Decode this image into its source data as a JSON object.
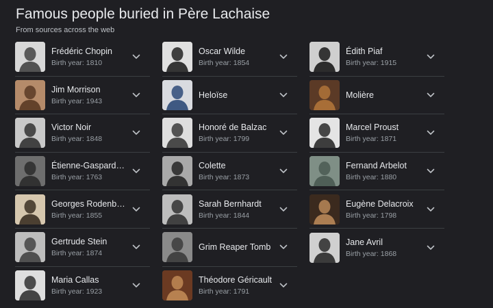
{
  "header": {
    "title": "Famous people buried in Père Lachaise",
    "subtitle": "From sources across the web"
  },
  "birth_prefix": "Birth year: ",
  "people": [
    {
      "name": "Frédéric Chopin",
      "birth": "1810",
      "thumb_bg": "#d8d8d8",
      "thumb_fg": "#444444"
    },
    {
      "name": "Oscar Wilde",
      "birth": "1854",
      "thumb_bg": "#e0e0e0",
      "thumb_fg": "#222222"
    },
    {
      "name": "Édith Piaf",
      "birth": "1915",
      "thumb_bg": "#cfcfcf",
      "thumb_fg": "#1a1a1a"
    },
    {
      "name": "Jim Morrison",
      "birth": "1943",
      "thumb_bg": "#b58b6a",
      "thumb_fg": "#5a3a24"
    },
    {
      "name": "Heloïse",
      "birth": "",
      "thumb_bg": "#d9dbe0",
      "thumb_fg": "#2e4a78"
    },
    {
      "name": "Molière",
      "birth": "",
      "thumb_bg": "#5b3a26",
      "thumb_fg": "#b0743a"
    },
    {
      "name": "Victor Noir",
      "birth": "1848",
      "thumb_bg": "#c9c9c9",
      "thumb_fg": "#333333"
    },
    {
      "name": "Honoré de Balzac",
      "birth": "1799",
      "thumb_bg": "#dedede",
      "thumb_fg": "#3a3a3a"
    },
    {
      "name": "Marcel Proust",
      "birth": "1871",
      "thumb_bg": "#e4e4e4",
      "thumb_fg": "#2a2a2a"
    },
    {
      "name": "Étienne-Gaspard R...",
      "birth": "1763",
      "thumb_bg": "#6e6e6e",
      "thumb_fg": "#2b2b2b"
    },
    {
      "name": "Colette",
      "birth": "1873",
      "thumb_bg": "#a9a9a9",
      "thumb_fg": "#262626"
    },
    {
      "name": "Fernand Arbelot",
      "birth": "1880",
      "thumb_bg": "#7f8f86",
      "thumb_fg": "#4a5a52"
    },
    {
      "name": "Georges Rodenbach",
      "birth": "1855",
      "thumb_bg": "#d6c7ae",
      "thumb_fg": "#3c3023"
    },
    {
      "name": "Sarah Bernhardt",
      "birth": "1844",
      "thumb_bg": "#bdbdbd",
      "thumb_fg": "#333333"
    },
    {
      "name": "Eugène Delacroix",
      "birth": "1798",
      "thumb_bg": "#3b2a1e",
      "thumb_fg": "#b98758"
    },
    {
      "name": "Gertrude Stein",
      "birth": "1874",
      "thumb_bg": "#bdbdbd",
      "thumb_fg": "#444444"
    },
    {
      "name": "Grim Reaper Tomb",
      "birth": "",
      "thumb_bg": "#8a8a8a",
      "thumb_fg": "#3b3b3b"
    },
    {
      "name": "Jane Avril",
      "birth": "1868",
      "thumb_bg": "#d0d0d0",
      "thumb_fg": "#2a2a2a"
    },
    {
      "name": "Maria Callas",
      "birth": "1923",
      "thumb_bg": "#dedede",
      "thumb_fg": "#333333"
    },
    {
      "name": "Théodore Géricault",
      "birth": "1791",
      "thumb_bg": "#6b3a22",
      "thumb_fg": "#c08a55"
    }
  ],
  "icons": {
    "expand": "chevron-down-icon"
  },
  "colors": {
    "background": "#1f1f23",
    "text_primary": "#e8eaed",
    "text_secondary": "#9aa0a6",
    "divider": "#3c4043"
  }
}
